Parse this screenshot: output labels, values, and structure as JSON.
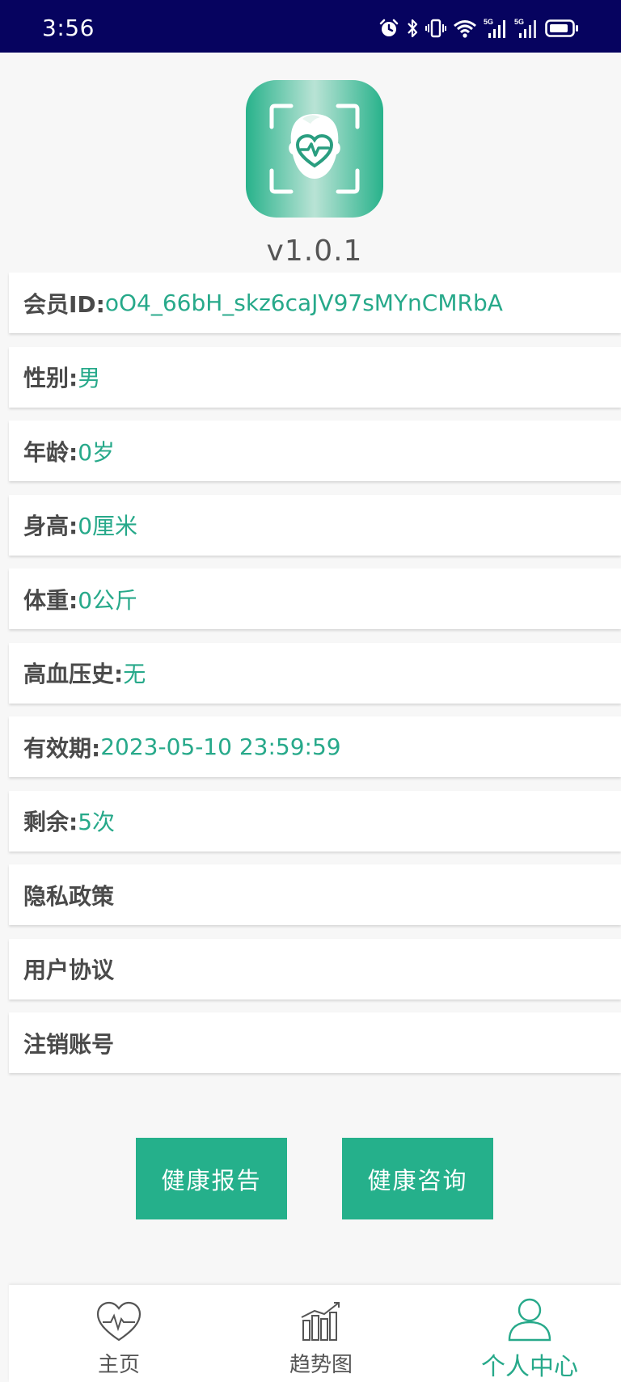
{
  "status_bar": {
    "time": "3:56",
    "icons": [
      "alarm-icon",
      "bluetooth-icon",
      "vibrate-icon",
      "wifi-icon",
      "signal-5g-icon",
      "signal-5g-icon",
      "battery-icon"
    ],
    "signal_label": "5G"
  },
  "app": {
    "logo_icon": "face-heart-scan-icon",
    "version": "v1.0.1"
  },
  "profile": {
    "rows": [
      {
        "label": "会员ID:",
        "value": "oO4_66bH_skz6caJV97sMYnCMRbA"
      },
      {
        "label": "性别:",
        "value": "男"
      },
      {
        "label": "年龄:",
        "value": "0岁"
      },
      {
        "label": "身高:",
        "value": "0厘米"
      },
      {
        "label": "体重:",
        "value": "0公斤"
      },
      {
        "label": "高血压史:",
        "value": "无"
      },
      {
        "label": "有效期:",
        "value": "2023-05-10 23:59:59"
      },
      {
        "label": "剩余:",
        "value": "5次"
      }
    ],
    "links": {
      "privacy": "隐私政策",
      "agreement": "用户协议",
      "cancel_account": "注销账号"
    }
  },
  "actions": {
    "health_report": "健康报告",
    "health_consult": "健康咨询"
  },
  "tabbar": {
    "home": "主页",
    "trend": "趋势图",
    "me": "个人中心"
  },
  "colors": {
    "status_bar": "#06035f",
    "accent": "#27a98a",
    "button": "#25b08b",
    "label": "#4a4a4a",
    "background": "#f7f7f7"
  }
}
